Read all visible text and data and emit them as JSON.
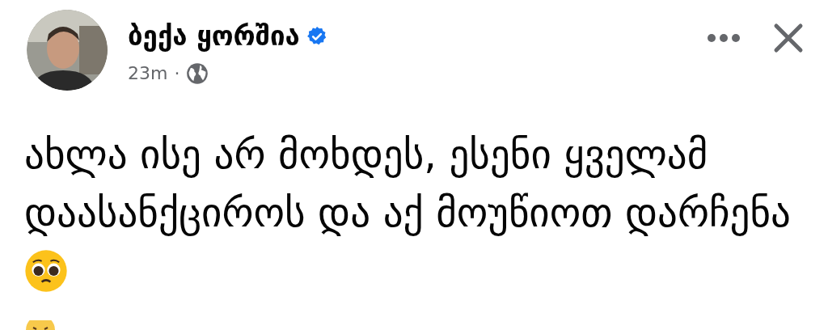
{
  "post": {
    "author": "ბექა ყორშია",
    "verified": true,
    "time": "23m",
    "separator": "·",
    "text": "ახლა ისე არ მოხდეს, ესენი ყველამ დაასანქციროს და აქ მოუწიოთ დარჩენა"
  }
}
